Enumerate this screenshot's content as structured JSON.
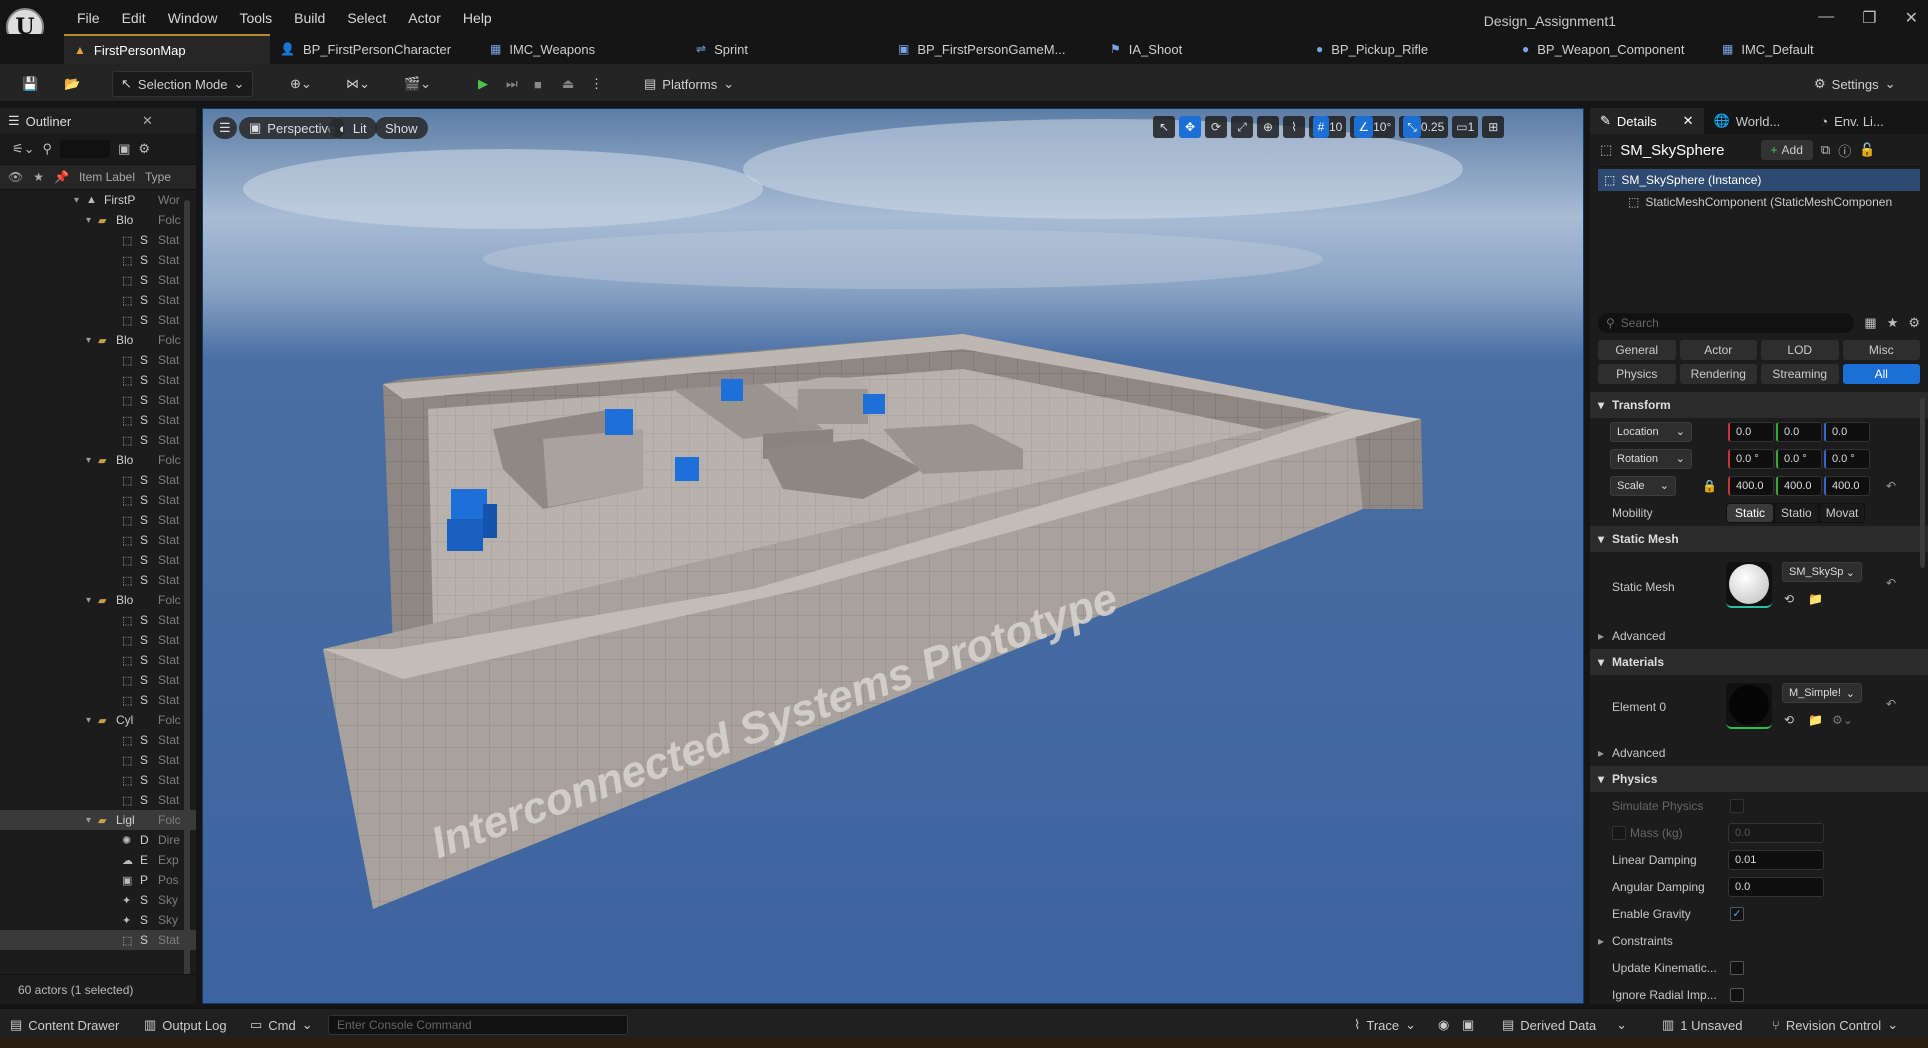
{
  "window": {
    "logo": "U",
    "project_name": "Design_Assignment1",
    "menu": [
      "File",
      "Edit",
      "Window",
      "Tools",
      "Build",
      "Select",
      "Actor",
      "Help"
    ],
    "controls": [
      "—",
      "❐",
      "✕"
    ]
  },
  "tabs": [
    {
      "label": "FirstPersonMap",
      "icon": "▲",
      "icon_name": "map-icon"
    },
    {
      "label": "BP_FirstPersonCharacter",
      "icon": "👤",
      "icon_name": "blueprint-actor-icon"
    },
    {
      "label": "IMC_Weapons",
      "icon": "▦",
      "icon_name": "input-mapping-icon"
    },
    {
      "label": "Sprint",
      "icon": "⇌",
      "icon_name": "input-action-icon"
    },
    {
      "label": "BP_FirstPersonGameM...",
      "icon": "▣",
      "icon_name": "blueprint-gamemode-icon"
    },
    {
      "label": "IA_Shoot",
      "icon": "⚑",
      "icon_name": "input-action-icon"
    },
    {
      "label": "BP_Pickup_Rifle",
      "icon": "●",
      "icon_name": "blueprint-actor-icon"
    },
    {
      "label": "BP_Weapon_Component",
      "icon": "●",
      "icon_name": "blueprint-component-icon"
    },
    {
      "label": "IMC_Default",
      "icon": "▦",
      "icon_name": "input-mapping-icon"
    }
  ],
  "toolbar": {
    "selection_mode": "Selection Mode",
    "platforms": "Platforms",
    "settings": "Settings"
  },
  "outliner": {
    "title": "Outliner",
    "col_label": "Item Label",
    "col_type": "Type",
    "footer": "60 actors (1 selected)",
    "rows": [
      {
        "indent": 0,
        "kind": "world",
        "label": "FirstP",
        "type": "Wor"
      },
      {
        "indent": 1,
        "kind": "folder",
        "label": "Blo",
        "type": "Folc"
      },
      {
        "indent": 2,
        "kind": "mesh",
        "label": "S",
        "type": "Stat"
      },
      {
        "indent": 2,
        "kind": "mesh",
        "label": "S",
        "type": "Stat"
      },
      {
        "indent": 2,
        "kind": "mesh",
        "label": "S",
        "type": "Stat"
      },
      {
        "indent": 2,
        "kind": "mesh",
        "label": "S",
        "type": "Stat"
      },
      {
        "indent": 2,
        "kind": "mesh",
        "label": "S",
        "type": "Stat"
      },
      {
        "indent": 1,
        "kind": "folder",
        "label": "Blo",
        "type": "Folc"
      },
      {
        "indent": 2,
        "kind": "mesh",
        "label": "S",
        "type": "Stat"
      },
      {
        "indent": 2,
        "kind": "mesh",
        "label": "S",
        "type": "Stat"
      },
      {
        "indent": 2,
        "kind": "mesh",
        "label": "S",
        "type": "Stat"
      },
      {
        "indent": 2,
        "kind": "mesh",
        "label": "S",
        "type": "Stat"
      },
      {
        "indent": 2,
        "kind": "mesh",
        "label": "S",
        "type": "Stat"
      },
      {
        "indent": 1,
        "kind": "folder",
        "label": "Blo",
        "type": "Folc"
      },
      {
        "indent": 2,
        "kind": "mesh",
        "label": "S",
        "type": "Stat"
      },
      {
        "indent": 2,
        "kind": "mesh",
        "label": "S",
        "type": "Stat"
      },
      {
        "indent": 2,
        "kind": "mesh",
        "label": "S",
        "type": "Stat"
      },
      {
        "indent": 2,
        "kind": "mesh",
        "label": "S",
        "type": "Stat"
      },
      {
        "indent": 2,
        "kind": "mesh",
        "label": "S",
        "type": "Stat"
      },
      {
        "indent": 2,
        "kind": "mesh",
        "label": "S",
        "type": "Stat"
      },
      {
        "indent": 1,
        "kind": "folder",
        "label": "Blo",
        "type": "Folc"
      },
      {
        "indent": 2,
        "kind": "mesh",
        "label": "S",
        "type": "Stat"
      },
      {
        "indent": 2,
        "kind": "mesh",
        "label": "S",
        "type": "Stat"
      },
      {
        "indent": 2,
        "kind": "mesh",
        "label": "S",
        "type": "Stat"
      },
      {
        "indent": 2,
        "kind": "mesh",
        "label": "S",
        "type": "Stat"
      },
      {
        "indent": 2,
        "kind": "mesh",
        "label": "S",
        "type": "Stat"
      },
      {
        "indent": 1,
        "kind": "folder",
        "label": "Cyl",
        "type": "Folc"
      },
      {
        "indent": 2,
        "kind": "mesh",
        "label": "S",
        "type": "Stat"
      },
      {
        "indent": 2,
        "kind": "mesh",
        "label": "S",
        "type": "Stat"
      },
      {
        "indent": 2,
        "kind": "mesh",
        "label": "S",
        "type": "Stat"
      },
      {
        "indent": 2,
        "kind": "mesh",
        "label": "S",
        "type": "Stat"
      },
      {
        "indent": 1,
        "kind": "folder",
        "label": "Ligl",
        "type": "Folc",
        "selected": true
      },
      {
        "indent": 2,
        "kind": "light",
        "label": "D",
        "type": "Dire"
      },
      {
        "indent": 2,
        "kind": "fog",
        "label": "E",
        "type": "Exp"
      },
      {
        "indent": 2,
        "kind": "post",
        "label": "P",
        "type": "Pos"
      },
      {
        "indent": 2,
        "kind": "sky",
        "label": "S",
        "type": "Sky"
      },
      {
        "indent": 2,
        "kind": "sky",
        "label": "S",
        "type": "Sky"
      },
      {
        "indent": 2,
        "kind": "mesh",
        "label": "S",
        "type": "Stat",
        "selected": true
      }
    ]
  },
  "viewport": {
    "perspective": "Perspective",
    "lit": "Lit",
    "show": "Show",
    "grid_snap": "10",
    "rot_snap": "10°",
    "scale_snap": "0.25",
    "camera_speed": "1",
    "wall_text": "Interconnected Systems Prototype"
  },
  "details": {
    "tabs": [
      "Details",
      "World...",
      "Env. Li..."
    ],
    "actor_name": "SM_SkySphere",
    "add_label": "Add",
    "components": [
      "SM_SkySphere (Instance)",
      "StaticMeshComponent (StaticMeshComponen"
    ],
    "search_placeholder": "Search",
    "filters_row1": [
      "General",
      "Actor",
      "LOD",
      "Misc"
    ],
    "filters_row2": [
      "Physics",
      "Rendering",
      "Streaming",
      "All"
    ],
    "transform": {
      "title": "Transform",
      "location_label": "Location",
      "location": [
        "0.0",
        "0.0",
        "0.0"
      ],
      "rotation_label": "Rotation",
      "rotation": [
        "0.0 °",
        "0.0 °",
        "0.0 °"
      ],
      "scale_label": "Scale",
      "scale": [
        "400.0",
        "400.0",
        "400.0"
      ],
      "mobility_label": "Mobility",
      "mobility": [
        "Static",
        "Statio",
        "Movat"
      ]
    },
    "static_mesh": {
      "title": "Static Mesh",
      "label": "Static Mesh",
      "value": "SM_SkySp",
      "advanced": "Advanced"
    },
    "materials": {
      "title": "Materials",
      "label": "Element 0",
      "value": "M_Simple!",
      "advanced": "Advanced"
    },
    "physics": {
      "title": "Physics",
      "simulate": "Simulate Physics",
      "mass_label": "Mass (kg)",
      "mass": "0.0",
      "linear_label": "Linear Damping",
      "linear": "0.01",
      "angular_label": "Angular Damping",
      "angular": "0.0",
      "gravity_label": "Enable Gravity",
      "constraints": "Constraints",
      "kinematic": "Update Kinematic...",
      "radial": "Ignore Radial Imp..."
    }
  },
  "bottom": {
    "content_drawer": "Content Drawer",
    "output_log": "Output Log",
    "cmd": "Cmd",
    "console_placeholder": "Enter Console Command",
    "trace": "Trace",
    "derived": "Derived Data",
    "unsaved": "1 Unsaved",
    "revision": "Revision Control"
  }
}
